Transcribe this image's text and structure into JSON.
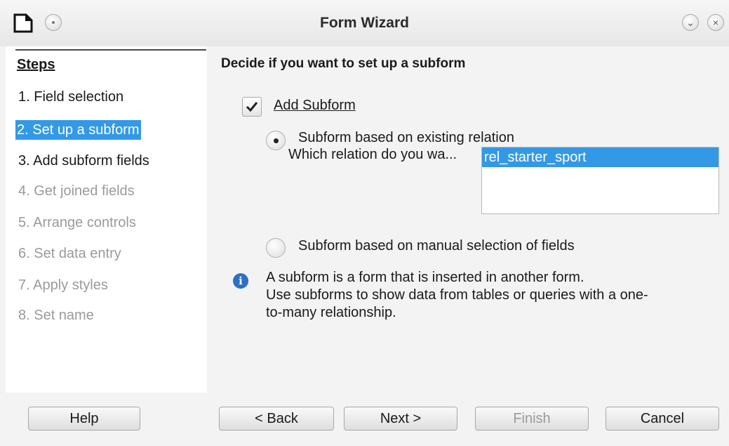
{
  "window": {
    "title": "Form Wizard"
  },
  "steps": {
    "title": "Steps",
    "items": [
      {
        "label": "1. Field selection",
        "state": "enabled"
      },
      {
        "label": "2. Set up a subform",
        "state": "active"
      },
      {
        "label": "3. Add subform fields",
        "state": "enabled"
      },
      {
        "label": "4. Get joined fields",
        "state": "disabled"
      },
      {
        "label": "5. Arrange controls",
        "state": "disabled"
      },
      {
        "label": "6. Set data entry",
        "state": "disabled"
      },
      {
        "label": "7. Apply styles",
        "state": "disabled"
      },
      {
        "label": "8. Set name",
        "state": "disabled"
      }
    ]
  },
  "main": {
    "heading": "Decide if you want to set up a subform",
    "add_subform": {
      "label": "Add Subform",
      "checked": true
    },
    "radio_existing": {
      "label": "Subform based on existing relation",
      "selected": true
    },
    "relation_prompt": "Which relation do you wa...",
    "relations": [
      "rel_starter_sport"
    ],
    "selected_relation": "rel_starter_sport",
    "radio_manual": {
      "label": "Subform based on manual selection of fields",
      "selected": false
    },
    "info_lines": [
      "A subform is a form that is inserted in another form.",
      "Use subforms to show data from tables or queries with a one-",
      "to-many relationship."
    ]
  },
  "buttons": {
    "help": "Help",
    "back": "< Back",
    "next": "Next >",
    "finish": "Finish",
    "cancel": "Cancel"
  },
  "colors": {
    "selection": "#3399e6",
    "info_icon": "#2d6fc1"
  }
}
